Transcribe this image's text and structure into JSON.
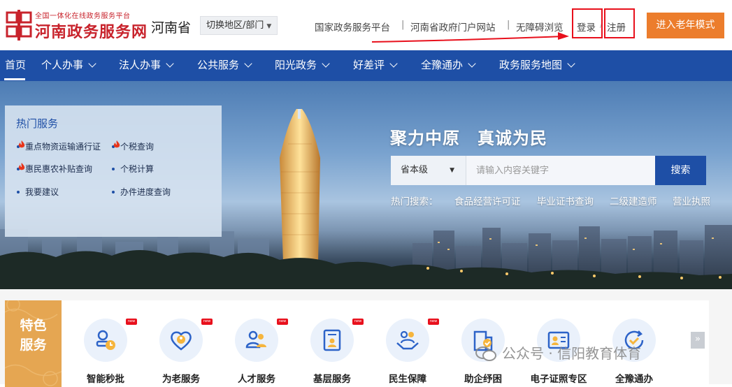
{
  "header": {
    "logo_sub": "全国一体化在线政务服务平台",
    "logo_main": "河南政务服务网",
    "province": "河南省",
    "switch_label": "切换地区/部门",
    "links": {
      "national": "国家政务服务平台",
      "portal": "河南省政府门户网站",
      "accessible": "无障碍浏览",
      "login": "登录",
      "register": "注册"
    },
    "elder_mode": "进入老年模式",
    "accent_color": "#c8232c",
    "elder_color": "#ec7d2c"
  },
  "nav": {
    "color": "#1e4fa6",
    "items": [
      {
        "label": "首页"
      },
      {
        "label": "个人办事"
      },
      {
        "label": "法人办事"
      },
      {
        "label": "公共服务"
      },
      {
        "label": "阳光政务"
      },
      {
        "label": "好差评"
      },
      {
        "label": "全豫通办"
      },
      {
        "label": "政务服务地图"
      }
    ]
  },
  "hot_services": {
    "title": "热门服务",
    "items": [
      {
        "label": "重点物资运输通行证",
        "hot": true
      },
      {
        "label": "个税查询",
        "hot": true
      },
      {
        "label": "惠民惠农补贴查询",
        "hot": true
      },
      {
        "label": "个税计算",
        "hot": false
      },
      {
        "label": "我要建议",
        "hot": false
      },
      {
        "label": "办件进度查询",
        "hot": false
      }
    ]
  },
  "hero": {
    "slogan": "聚力中原　真诚为民",
    "search": {
      "scope": "省本级",
      "placeholder": "请输入内容关键字",
      "button": "搜索"
    },
    "hot_search_label": "热门搜索：",
    "hot_search_terms": [
      "食品经营许可证",
      "毕业证书查询",
      "二级建造师",
      "营业执照"
    ]
  },
  "feature": {
    "line1": "特色",
    "line2": "服务"
  },
  "services": [
    {
      "label": "智能秒批",
      "icon": "stamp-clock-icon",
      "new": true
    },
    {
      "label": "为老服务",
      "icon": "heart-elder-icon",
      "new": true
    },
    {
      "label": "人才服务",
      "icon": "people-icon",
      "new": true
    },
    {
      "label": "基层服务",
      "icon": "document-user-icon",
      "new": true
    },
    {
      "label": "民生保障",
      "icon": "hands-people-icon",
      "new": true
    },
    {
      "label": "助企纾困",
      "icon": "enterprise-icon",
      "new": false
    },
    {
      "label": "电子证照专区",
      "icon": "id-card-icon",
      "new": false
    },
    {
      "label": "全豫通办",
      "icon": "check-cycle-icon",
      "new": false
    }
  ],
  "new_badge": "new",
  "scroll_label": "»",
  "watermark": "公众号 · 信阳教育体育"
}
